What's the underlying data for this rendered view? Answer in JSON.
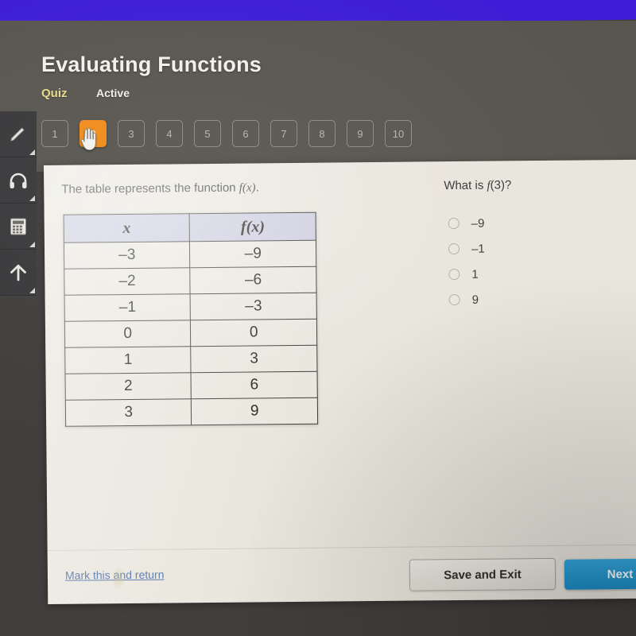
{
  "header": {
    "title": "Evaluating Functions",
    "section_label": "Quiz",
    "status_label": "Active",
    "accent_color": "#ef8c1c",
    "band_color": "#3d1ed6",
    "quiz_label_color": "#e9d98c"
  },
  "question_nav": {
    "items": [
      {
        "label": "1",
        "active": false
      },
      {
        "label": "2",
        "active": true
      },
      {
        "label": "3",
        "active": false
      },
      {
        "label": "4",
        "active": false
      },
      {
        "label": "5",
        "active": false
      },
      {
        "label": "6",
        "active": false
      },
      {
        "label": "7",
        "active": false
      },
      {
        "label": "8",
        "active": false
      },
      {
        "label": "9",
        "active": false
      },
      {
        "label": "10",
        "active": false
      }
    ],
    "current": "2"
  },
  "toolbar": {
    "items": [
      {
        "icon": "highlighter-icon"
      },
      {
        "icon": "headphones-icon"
      },
      {
        "icon": "calculator-icon"
      },
      {
        "icon": "up-arrow-icon"
      }
    ]
  },
  "main": {
    "prompt_prefix": "The table represents the function ",
    "prompt_function": "f(x)",
    "prompt_suffix": ".",
    "question_prefix": "What is ",
    "question_function": "f",
    "question_suffix": "(3)?",
    "table": {
      "columns": [
        "x",
        "f(x)"
      ],
      "rows": [
        [
          "–3",
          "–9"
        ],
        [
          "–2",
          "–6"
        ],
        [
          "–1",
          "–3"
        ],
        [
          "0",
          "0"
        ],
        [
          "1",
          "3"
        ],
        [
          "2",
          "6"
        ],
        [
          "3",
          "9"
        ]
      ]
    },
    "options": [
      {
        "label": "–9",
        "selected": false
      },
      {
        "label": "–1",
        "selected": false
      },
      {
        "label": "1",
        "selected": false
      },
      {
        "label": "9",
        "selected": false
      }
    ]
  },
  "footer": {
    "mark_return_label": "Mark this and return",
    "save_exit_label": "Save and Exit",
    "next_label": "Next",
    "next_color": "#2196d6",
    "link_color": "#4b6fa8"
  }
}
